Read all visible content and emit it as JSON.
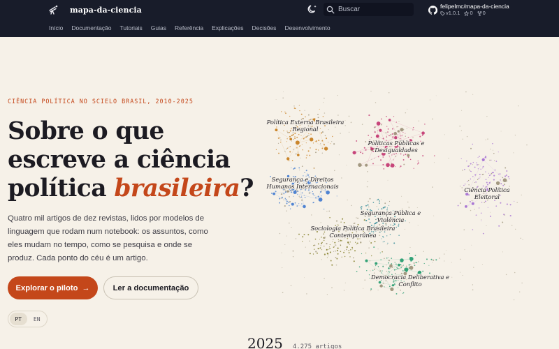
{
  "header": {
    "brand_title": "mapa-da-ciencia",
    "search_placeholder": "Buscar",
    "repo": {
      "name": "felipelmc/mapa-da-ciencia",
      "version": "v1.0.1",
      "stars": "0",
      "forks": "0"
    },
    "nav": [
      "Início",
      "Documentação",
      "Tutoriais",
      "Guias",
      "Referência",
      "Explicações",
      "Decisões",
      "Desenvolvimento"
    ],
    "active_nav": "Início"
  },
  "hero": {
    "eyebrow": "CIÊNCIA POLÍTICA NO SCIELO BRASIL, 2010-2025",
    "headline_line1": "Sobre o que",
    "headline_line2": "escreve a ciência",
    "headline_line3_start": "política ",
    "headline_accent": "brasileira",
    "headline_end": "?",
    "lede": "Quatro mil artigos de dez revistas, lidos por modelos de linguagem que rodam num notebook: os assuntos, como eles mudam no tempo, como se pesquisa e onde se produz. Cada ponto do céu é um artigo.",
    "primary_button": "Explorar o piloto",
    "primary_arrow": "→",
    "secondary_button": "Ler a documentação",
    "lang_options": [
      "PT",
      "EN"
    ],
    "active_lang": "PT"
  },
  "timeline": {
    "year": "2025",
    "count": "4.275 artigos"
  },
  "map": {
    "clusters": [
      {
        "name": "Política Externa Brasileira Regional",
        "lines": [
          "Política Externa Brasileira",
          "Regional"
        ],
        "color": "#c57a17"
      },
      {
        "name": "Políticas Públicas e Desigualdades",
        "lines": [
          "Políticas Públicas e",
          "Desigualdades"
        ],
        "color": "#c2336f"
      },
      {
        "name": "Segurança e Direitos Humanos Internacionais",
        "lines": [
          "Segurança e Direitos",
          "Humanos Internacionais"
        ],
        "color": "#3e78cf"
      },
      {
        "name": "Ciência Política Eleitoral",
        "lines": [
          "Ciência Política",
          "Eleitoral"
        ],
        "color": "#a36bd1"
      },
      {
        "name": "Segurança Pública e Violência",
        "lines": [
          "Segurança Pública e",
          "Violência"
        ],
        "color": "#1e7f8f"
      },
      {
        "name": "Sociologia Política Brasileira Contemporânea",
        "lines": [
          "Sociologia Política Brasileira",
          "Contemporânea"
        ],
        "color": "#7a7418"
      },
      {
        "name": "Democracia Deliberativa e Conflito",
        "lines": [
          "Democracia Deliberativa e",
          "Conflito"
        ],
        "color": "#1f9a6c"
      }
    ]
  }
}
